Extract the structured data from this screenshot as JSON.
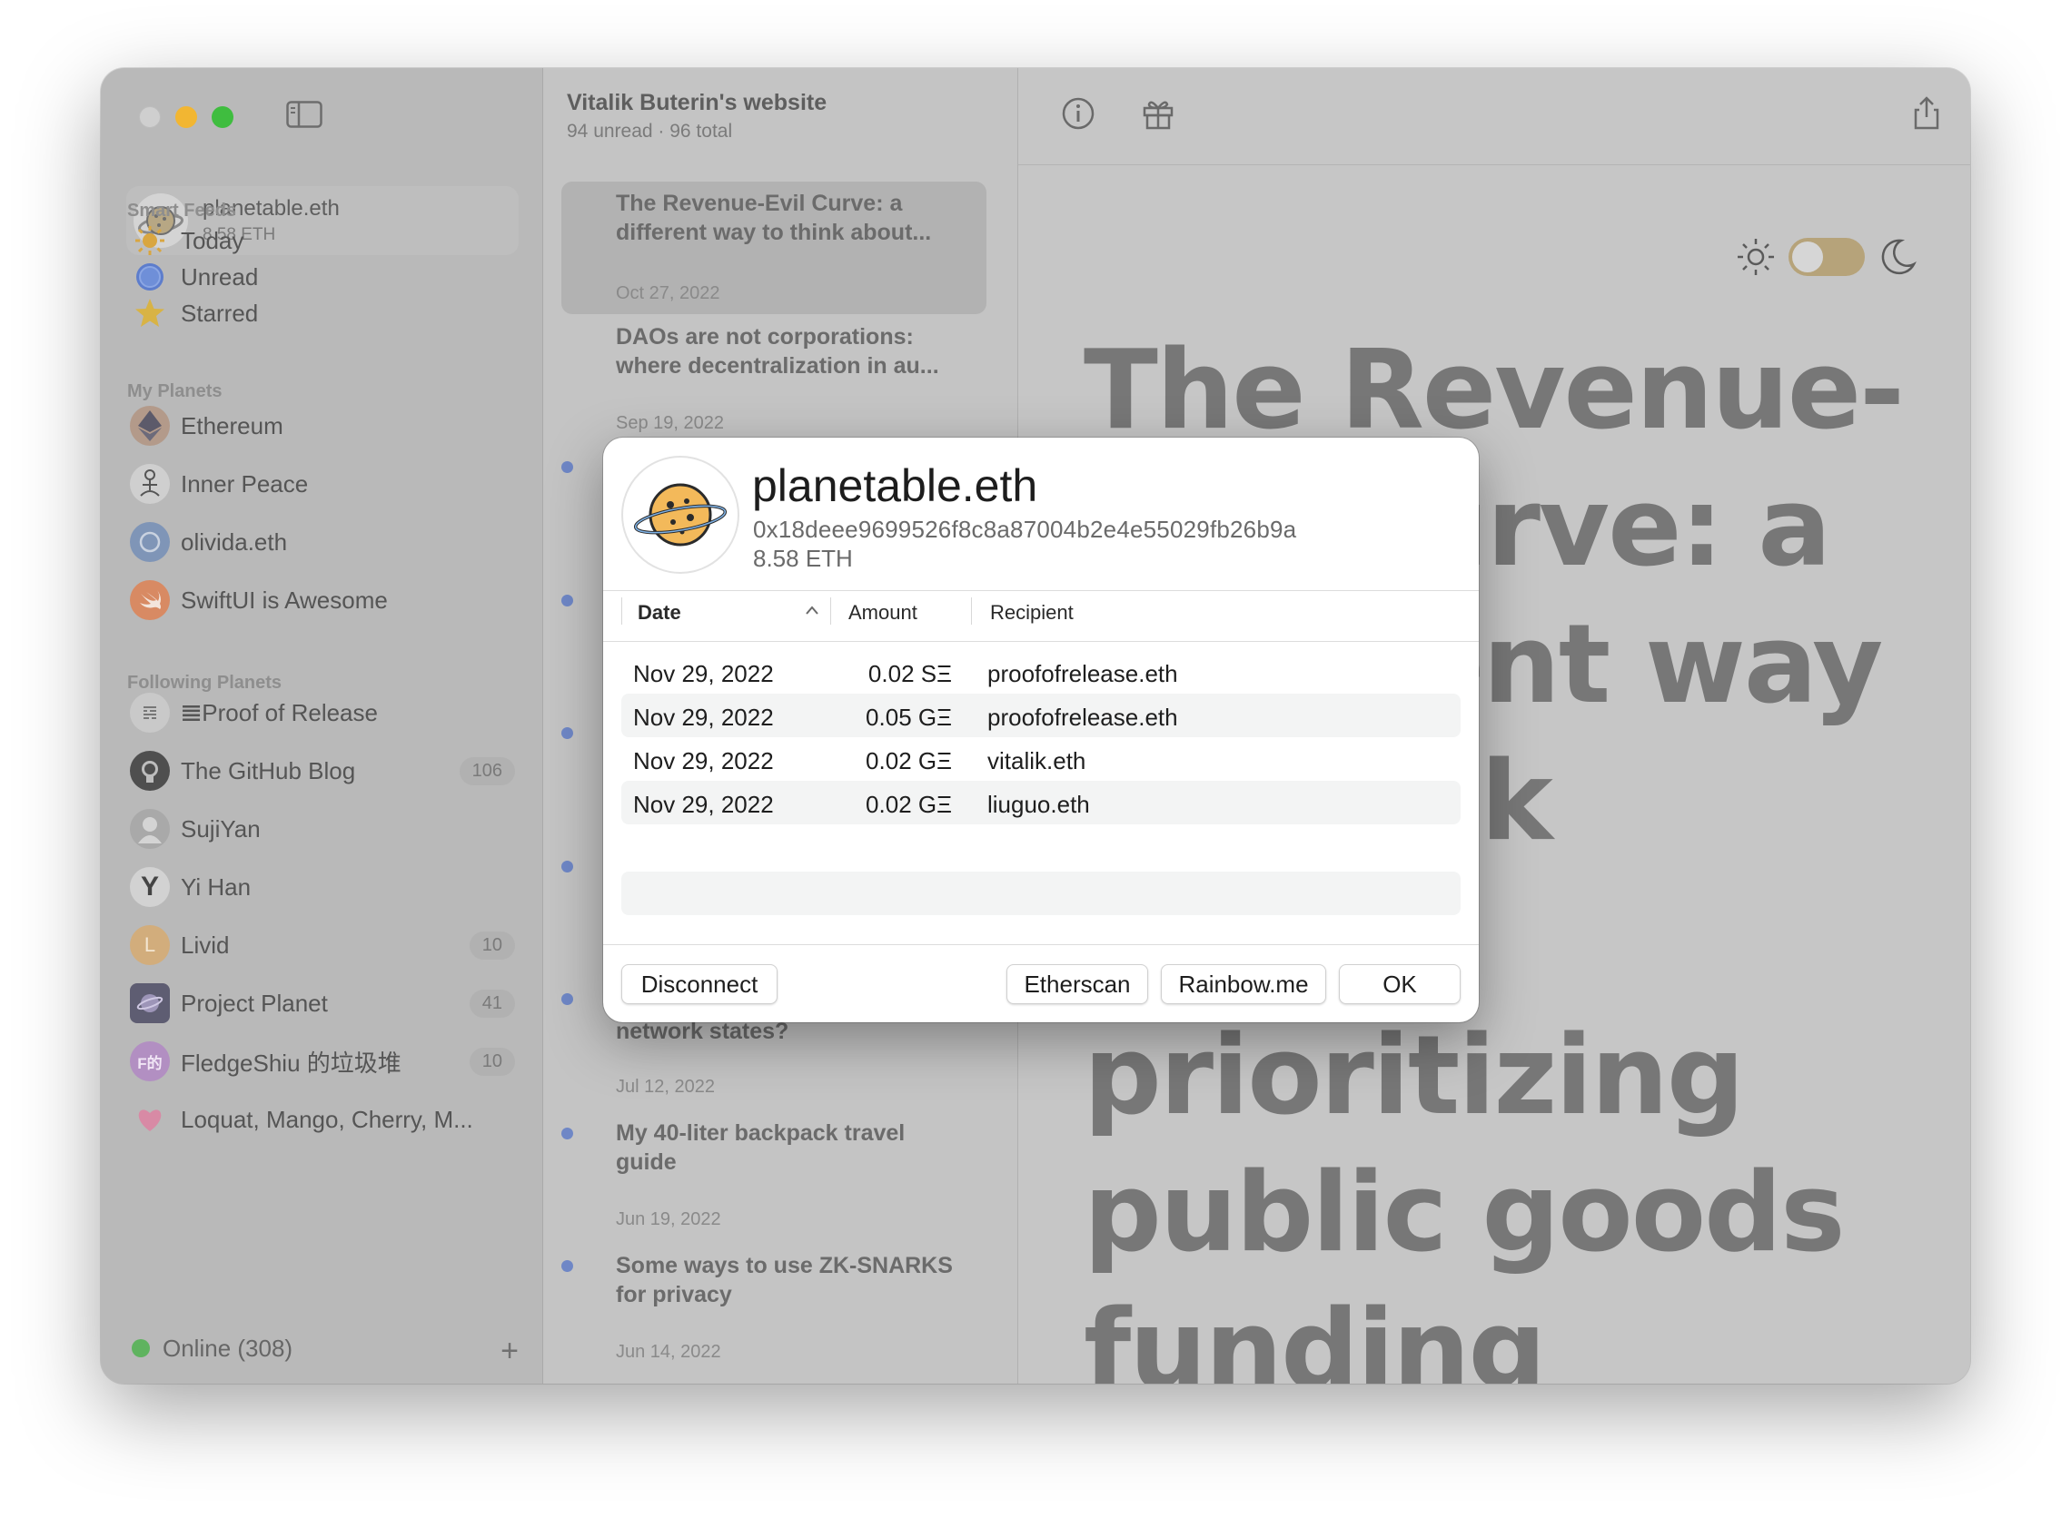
{
  "wallet": {
    "name": "planetable.eth",
    "balance": "8.58 ETH"
  },
  "smart_feeds": {
    "title": "Smart Feeds",
    "items": [
      {
        "label": "Today",
        "icon": "sun-icon"
      },
      {
        "label": "Unread",
        "icon": "unread-circle-icon"
      },
      {
        "label": "Starred",
        "icon": "star-icon"
      }
    ]
  },
  "my_planets": {
    "title": "My Planets",
    "items": [
      {
        "label": "Ethereum"
      },
      {
        "label": "Inner Peace"
      },
      {
        "label": "olivida.eth"
      },
      {
        "label": "SwiftUI is Awesome"
      }
    ]
  },
  "following": {
    "title": "Following Planets",
    "items": [
      {
        "label": "𝌆Proof of Release",
        "badge": ""
      },
      {
        "label": "The GitHub Blog",
        "badge": "106"
      },
      {
        "label": "SujiYan",
        "badge": ""
      },
      {
        "label": "Yi Han",
        "badge": ""
      },
      {
        "label": "Livid",
        "badge": "10"
      },
      {
        "label": "Project Planet",
        "badge": "41"
      },
      {
        "label": "FledgeShiu 的垃圾堆",
        "badge": "10"
      },
      {
        "label": "Loquat, Mango, Cherry, M...",
        "badge": ""
      }
    ],
    "livid_initial": "L",
    "fledge_initial": "F的",
    "yi_han_initial": "Y"
  },
  "status": {
    "label": "Online (308)"
  },
  "list": {
    "title": "Vitalik Buterin's website",
    "subtitle": "94 unread · 96 total",
    "articles": [
      {
        "title": "The Revenue-Evil Curve: a different way to think about...",
        "date": "Oct 27, 2022"
      },
      {
        "title": "DAOs are not corporations: where decentralization in au...",
        "date": "Sep 19, 2022"
      },
      {
        "title": "network states?",
        "date": "Jul 12, 2022"
      },
      {
        "title": "My 40-liter backpack travel guide",
        "date": "Jun 19, 2022"
      },
      {
        "title": "Some ways to use ZK-SNARKS for privacy",
        "date": "Jun 14, 2022"
      }
    ]
  },
  "detail": {
    "big_title": "The Revenue-Evil Curve: a different way to think about prioritizing public goods funding"
  },
  "dialog": {
    "name": "planetable.eth",
    "address": "0x18deee9699526f8c8a87004b2e4e55029fb26b9a",
    "balance": "8.58 ETH",
    "columns": {
      "date": "Date",
      "amount": "Amount",
      "recipient": "Recipient"
    },
    "rows": [
      {
        "date": "Nov 29, 2022",
        "amount": "0.02 SΞ",
        "recipient": "proofofrelease.eth"
      },
      {
        "date": "Nov 29, 2022",
        "amount": "0.05 GΞ",
        "recipient": "proofofrelease.eth"
      },
      {
        "date": "Nov 29, 2022",
        "amount": "0.02 GΞ",
        "recipient": "vitalik.eth"
      },
      {
        "date": "Nov 29, 2022",
        "amount": "0.02 GΞ",
        "recipient": "liuguo.eth"
      }
    ],
    "buttons": {
      "disconnect": "Disconnect",
      "etherscan": "Etherscan",
      "rainbow": "Rainbow.me",
      "ok": "OK"
    }
  }
}
